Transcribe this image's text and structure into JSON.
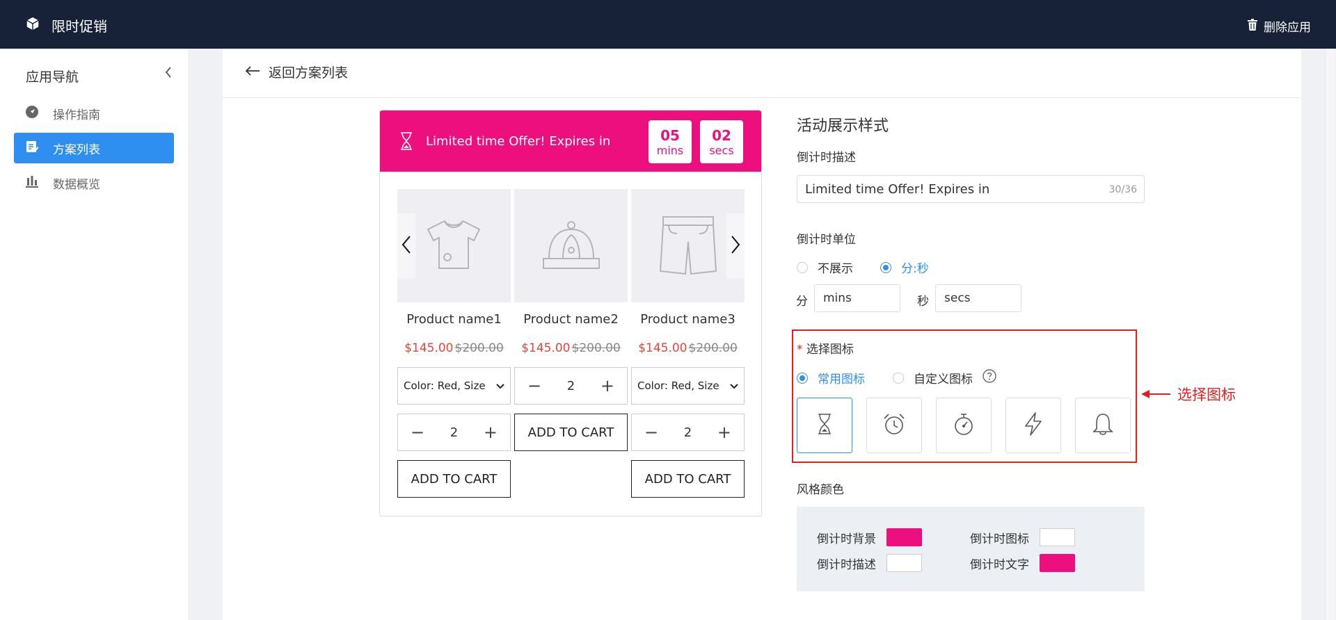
{
  "topbar": {
    "app_title": "限时促销",
    "delete_label": "删除应用"
  },
  "sidebar": {
    "title": "应用导航",
    "items": [
      {
        "label": "操作指南",
        "icon": "compass-icon",
        "active": false
      },
      {
        "label": "方案列表",
        "icon": "document-edit-icon",
        "active": true
      },
      {
        "label": "数据概览",
        "icon": "bar-chart-icon",
        "active": false
      }
    ]
  },
  "main": {
    "back_label": "返回方案列表"
  },
  "preview": {
    "banner_text": "Limited time Offer! Expires in",
    "timer": {
      "mins_value": "05",
      "mins_unit": "mins",
      "secs_value": "02",
      "secs_unit": "secs"
    },
    "products": [
      {
        "name": "Product name1",
        "price": "$145.00",
        "old_price": "$200.00",
        "icon": "tshirt-icon"
      },
      {
        "name": "Product name2",
        "price": "$145.00",
        "old_price": "$200.00",
        "icon": "hat-icon"
      },
      {
        "name": "Product name3",
        "price": "$145.00",
        "old_price": "$200.00",
        "icon": "shorts-icon"
      }
    ],
    "variant_select": "Color: Red, Size",
    "quantity": "2",
    "add_to_cart": "ADD TO CART"
  },
  "settings": {
    "section_title": "活动展示样式",
    "countdown_desc_label": "倒计时描述",
    "countdown_desc_value": "Limited time Offer! Expires in",
    "countdown_desc_count": "30/36",
    "unit_label": "倒计时单位",
    "unit_options": [
      "不展示",
      "分:秒"
    ],
    "unit_selected": "分:秒",
    "min_prefix": "分",
    "min_value": "mins",
    "sec_prefix": "秒",
    "sec_value": "secs",
    "icon_label_required": "*",
    "icon_label": "选择图标",
    "icon_options": [
      "常用图标",
      "自定义图标"
    ],
    "icon_selected": "常用图标",
    "icons": [
      "hourglass-icon",
      "alarm-clock-icon",
      "stopwatch-icon",
      "lightning-icon",
      "bell-icon"
    ],
    "style_color_label": "风格颜色",
    "colors": {
      "bg_label": "倒计时背景",
      "bg_color": "#ee0f7e",
      "icon_label": "倒计时图标",
      "icon_color": "#ffffff",
      "desc_label": "倒计时描述",
      "desc_color": "#ffffff",
      "text_label": "倒计时文字",
      "text_color": "#ee0f7e"
    }
  },
  "annotation": {
    "text": "选择图标"
  }
}
